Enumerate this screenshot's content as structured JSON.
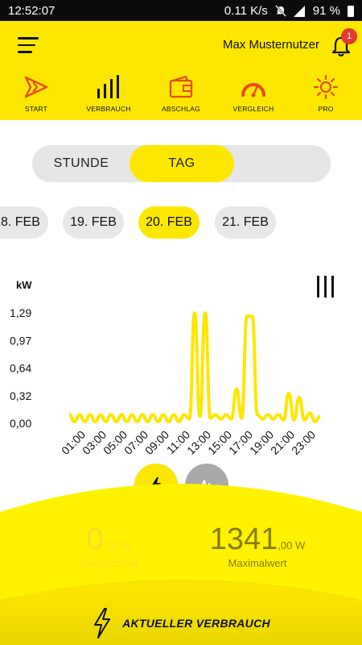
{
  "status_bar": {
    "time": "12:52:07",
    "network_speed": "0.11 K/s",
    "network_type": "4G",
    "battery": "91 %"
  },
  "header": {
    "user_name": "Max Musternutzer",
    "notification_count": "1",
    "accent_color": "#fde700"
  },
  "nav": [
    {
      "label": "START",
      "icon": "start-icon"
    },
    {
      "label": "VERBRAUCH",
      "icon": "consumption-bars-icon"
    },
    {
      "label": "ABSCHLAG",
      "icon": "wallet-icon"
    },
    {
      "label": "VERGLEICH",
      "icon": "gauge-icon"
    },
    {
      "label": "PRO",
      "icon": "sun-icon"
    }
  ],
  "period_toggle": {
    "options": [
      "STUNDE",
      "TAG"
    ],
    "selected": "TAG"
  },
  "dates": [
    {
      "label": "18. FEB",
      "active": false
    },
    {
      "label": "19. FEB",
      "active": false
    },
    {
      "label": "20. FEB",
      "active": true
    },
    {
      "label": "21. FEB",
      "active": false
    }
  ],
  "chart_data": {
    "type": "line",
    "ylabel": "kW",
    "y_ticks": [
      "1,29",
      "0,97",
      "0,64",
      "0,32",
      "0,00"
    ],
    "ylim": [
      0,
      1.29
    ],
    "x_ticks": [
      "01:00",
      "03:00",
      "05:00",
      "07:00",
      "09:00",
      "11:00",
      "13:00",
      "15:00",
      "17:00",
      "19:00",
      "21:00",
      "23:00"
    ],
    "x": [
      0,
      0.5,
      1,
      1.5,
      2,
      2.5,
      3,
      3.5,
      4,
      4.5,
      5,
      5.5,
      6,
      6.5,
      7,
      7.5,
      8,
      8.5,
      9,
      9.5,
      10,
      10.5,
      11,
      11.5,
      12,
      12.5,
      13,
      13.5,
      14,
      14.5,
      15,
      15.5,
      16,
      16.5,
      17,
      17.5,
      18,
      18.5,
      19,
      19.5,
      20,
      20.5,
      21,
      21.5,
      22,
      22.5,
      23,
      23.5,
      24
    ],
    "values": [
      0.1,
      0.02,
      0.1,
      0.02,
      0.1,
      0.02,
      0.1,
      0.02,
      0.1,
      0.02,
      0.1,
      0.02,
      0.1,
      0.02,
      0.1,
      0.02,
      0.1,
      0.02,
      0.1,
      0.02,
      0.1,
      0.02,
      0.1,
      0.05,
      1.29,
      0.08,
      1.29,
      0.06,
      0.1,
      0.05,
      0.1,
      0.05,
      0.4,
      0.06,
      1.25,
      1.25,
      0.1,
      0.05,
      0.1,
      0.05,
      0.1,
      0.04,
      0.35,
      0.04,
      0.3,
      0.04,
      0.12,
      0.02,
      0.08
    ],
    "grid": false,
    "color": "#fde700"
  },
  "modes": {
    "power": "power-bolt-icon",
    "pulse": "pulse-icon"
  },
  "stats": {
    "current_value": "0",
    "current_unit": ",00 W",
    "current_caption": "Durchschnitt",
    "max_value": "1341",
    "max_unit": ",00 W",
    "max_caption": "Maximalwert"
  },
  "footer": {
    "label": "AKTUELLER VERBRAUCH"
  }
}
